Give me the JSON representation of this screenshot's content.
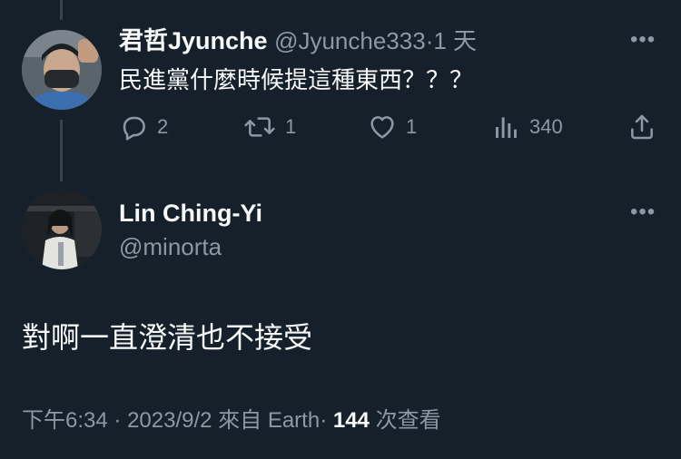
{
  "reply": {
    "display_name": "君哲Jyunche",
    "handle": "@Jyunche333",
    "separator": "·",
    "time_ago": "1 天",
    "text": "民進黨什麼時候提這種東西？？？",
    "actions": {
      "replies": "2",
      "retweets": "1",
      "likes": "1",
      "views": "340"
    }
  },
  "main_tweet": {
    "display_name": "Lin Ching-Yi",
    "handle": "@minorta",
    "text": "對啊一直澄清也不接受",
    "meta": {
      "time": "下午6:34",
      "sep1": "·",
      "date": "2023/9/2",
      "source": "來自 Earth",
      "sep2": "·",
      "views_count": "144",
      "views_label": "次查看"
    }
  },
  "colors": {
    "background": "#15202b",
    "text_primary": "#f7f9f9",
    "text_secondary": "#8b98a5",
    "thread_line": "#38444d"
  },
  "icons": [
    "more-icon",
    "reply-icon",
    "retweet-icon",
    "like-icon",
    "views-icon",
    "share-icon"
  ]
}
